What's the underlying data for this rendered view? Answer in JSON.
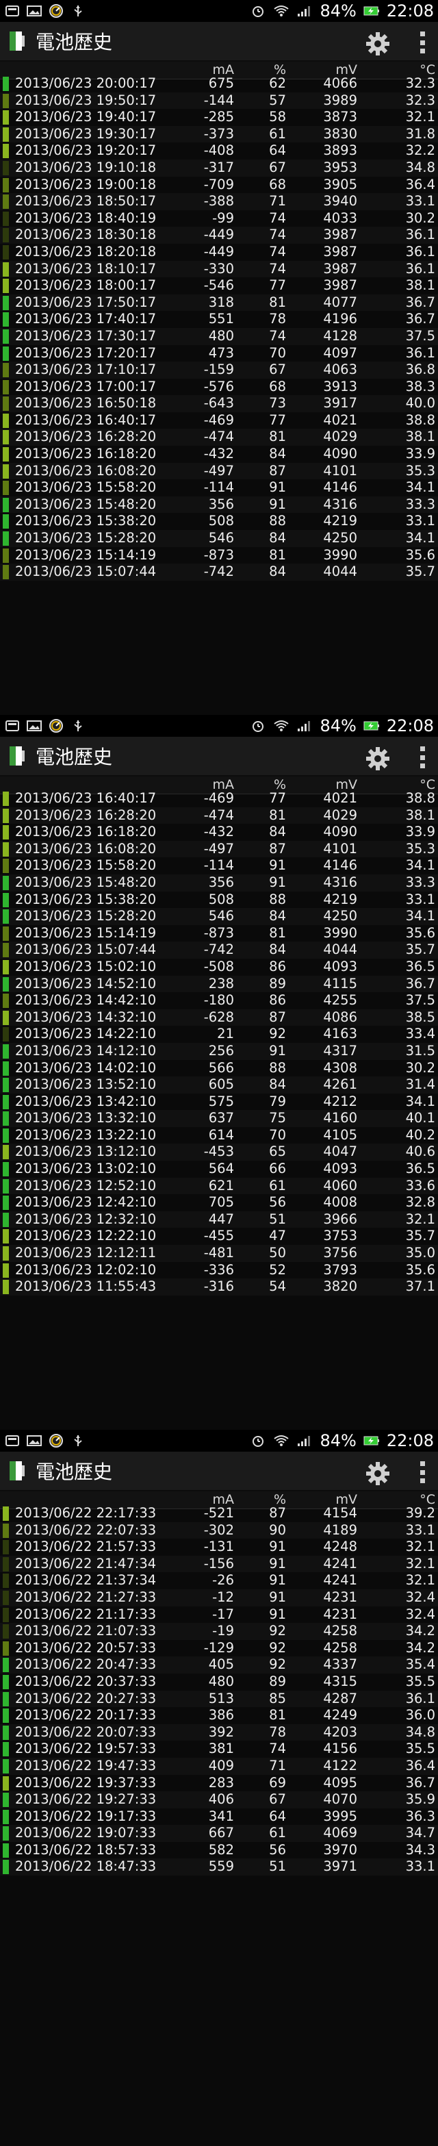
{
  "status": {
    "battery_pct": "84%",
    "clock": "22:08"
  },
  "app": {
    "title": "電池歴史"
  },
  "columns": {
    "ma": "mA",
    "pct": "%",
    "mv": "mV",
    "temp": "°C"
  },
  "colors": {
    "bar_green": "#2fb52f",
    "bar_yellow_green": "#8ab51f",
    "bar_olive": "#5f7a12",
    "bar_dark": "#2d3a0c"
  },
  "panels": [
    {
      "rows": [
        [
          "2013/06/23 20:00:17",
          "675",
          "62",
          "4066",
          "32.3",
          "green"
        ],
        [
          "2013/06/23 19:50:17",
          "-144",
          "57",
          "3989",
          "32.3",
          "olive"
        ],
        [
          "2013/06/23 19:40:17",
          "-285",
          "58",
          "3873",
          "32.1",
          "yg"
        ],
        [
          "2013/06/23 19:30:17",
          "-373",
          "61",
          "3830",
          "31.8",
          "yg"
        ],
        [
          "2013/06/23 19:20:17",
          "-408",
          "64",
          "3893",
          "32.2",
          "yg"
        ],
        [
          "2013/06/23 19:10:18",
          "-317",
          "67",
          "3953",
          "34.8",
          "dark"
        ],
        [
          "2013/06/23 19:00:18",
          "-709",
          "68",
          "3905",
          "36.4",
          "olive"
        ],
        [
          "2013/06/23 18:50:17",
          "-388",
          "71",
          "3940",
          "33.1",
          "olive"
        ],
        [
          "2013/06/23 18:40:19",
          "-99",
          "74",
          "4033",
          "30.2",
          "dark"
        ],
        [
          "2013/06/23 18:30:18",
          "-449",
          "74",
          "3987",
          "36.1",
          "dark"
        ],
        [
          "2013/06/23 18:20:18",
          "-449",
          "74",
          "3987",
          "36.1",
          "dark"
        ],
        [
          "2013/06/23 18:10:17",
          "-330",
          "74",
          "3987",
          "36.1",
          "yg"
        ],
        [
          "2013/06/23 18:00:17",
          "-546",
          "77",
          "3987",
          "38.1",
          "yg"
        ],
        [
          "2013/06/23 17:50:17",
          "318",
          "81",
          "4077",
          "36.7",
          "green"
        ],
        [
          "2013/06/23 17:40:17",
          "551",
          "78",
          "4196",
          "36.7",
          "green"
        ],
        [
          "2013/06/23 17:30:17",
          "480",
          "74",
          "4128",
          "37.5",
          "green"
        ],
        [
          "2013/06/23 17:20:17",
          "473",
          "70",
          "4097",
          "36.1",
          "green"
        ],
        [
          "2013/06/23 17:10:17",
          "-159",
          "67",
          "4063",
          "36.8",
          "olive"
        ],
        [
          "2013/06/23 17:00:17",
          "-576",
          "68",
          "3913",
          "38.3",
          "olive"
        ],
        [
          "2013/06/23 16:50:18",
          "-643",
          "73",
          "3917",
          "40.0",
          "olive"
        ],
        [
          "2013/06/23 16:40:17",
          "-469",
          "77",
          "4021",
          "38.8",
          "yg"
        ],
        [
          "2013/06/23 16:28:20",
          "-474",
          "81",
          "4029",
          "38.1",
          "yg"
        ],
        [
          "2013/06/23 16:18:20",
          "-432",
          "84",
          "4090",
          "33.9",
          "yg"
        ],
        [
          "2013/06/23 16:08:20",
          "-497",
          "87",
          "4101",
          "35.3",
          "yg"
        ],
        [
          "2013/06/23 15:58:20",
          "-114",
          "91",
          "4146",
          "34.1",
          "olive"
        ],
        [
          "2013/06/23 15:48:20",
          "356",
          "91",
          "4316",
          "33.3",
          "green"
        ],
        [
          "2013/06/23 15:38:20",
          "508",
          "88",
          "4219",
          "33.1",
          "green"
        ],
        [
          "2013/06/23 15:28:20",
          "546",
          "84",
          "4250",
          "34.1",
          "green"
        ],
        [
          "2013/06/23 15:14:19",
          "-873",
          "81",
          "3990",
          "35.6",
          "olive"
        ],
        [
          "2013/06/23 15:07:44",
          "-742",
          "84",
          "4044",
          "35.7",
          "olive"
        ]
      ]
    },
    {
      "rows": [
        [
          "2013/06/23 16:40:17",
          "-469",
          "77",
          "4021",
          "38.8",
          "yg"
        ],
        [
          "2013/06/23 16:28:20",
          "-474",
          "81",
          "4029",
          "38.1",
          "yg"
        ],
        [
          "2013/06/23 16:18:20",
          "-432",
          "84",
          "4090",
          "33.9",
          "yg"
        ],
        [
          "2013/06/23 16:08:20",
          "-497",
          "87",
          "4101",
          "35.3",
          "yg"
        ],
        [
          "2013/06/23 15:58:20",
          "-114",
          "91",
          "4146",
          "34.1",
          "olive"
        ],
        [
          "2013/06/23 15:48:20",
          "356",
          "91",
          "4316",
          "33.3",
          "green"
        ],
        [
          "2013/06/23 15:38:20",
          "508",
          "88",
          "4219",
          "33.1",
          "green"
        ],
        [
          "2013/06/23 15:28:20",
          "546",
          "84",
          "4250",
          "34.1",
          "green"
        ],
        [
          "2013/06/23 15:14:19",
          "-873",
          "81",
          "3990",
          "35.6",
          "olive"
        ],
        [
          "2013/06/23 15:07:44",
          "-742",
          "84",
          "4044",
          "35.7",
          "olive"
        ],
        [
          "2013/06/23 15:02:10",
          "-508",
          "86",
          "4093",
          "36.5",
          "yg"
        ],
        [
          "2013/06/23 14:52:10",
          "238",
          "89",
          "4115",
          "36.7",
          "green"
        ],
        [
          "2013/06/23 14:42:10",
          "-180",
          "86",
          "4255",
          "37.5",
          "olive"
        ],
        [
          "2013/06/23 14:32:10",
          "-628",
          "87",
          "4086",
          "38.5",
          "yg"
        ],
        [
          "2013/06/23 14:22:10",
          "21",
          "92",
          "4163",
          "33.4",
          "dark"
        ],
        [
          "2013/06/23 14:12:10",
          "256",
          "91",
          "4317",
          "31.5",
          "green"
        ],
        [
          "2013/06/23 14:02:10",
          "566",
          "88",
          "4308",
          "30.2",
          "green"
        ],
        [
          "2013/06/23 13:52:10",
          "605",
          "84",
          "4261",
          "31.4",
          "green"
        ],
        [
          "2013/06/23 13:42:10",
          "575",
          "79",
          "4212",
          "34.1",
          "green"
        ],
        [
          "2013/06/23 13:32:10",
          "637",
          "75",
          "4160",
          "40.1",
          "green"
        ],
        [
          "2013/06/23 13:22:10",
          "614",
          "70",
          "4105",
          "40.2",
          "green"
        ],
        [
          "2013/06/23 13:12:10",
          "-453",
          "65",
          "4047",
          "40.6",
          "yg"
        ],
        [
          "2013/06/23 13:02:10",
          "564",
          "66",
          "4093",
          "36.5",
          "green"
        ],
        [
          "2013/06/23 12:52:10",
          "621",
          "61",
          "4060",
          "33.6",
          "green"
        ],
        [
          "2013/06/23 12:42:10",
          "705",
          "56",
          "4008",
          "32.8",
          "green"
        ],
        [
          "2013/06/23 12:32:10",
          "447",
          "51",
          "3966",
          "32.1",
          "green"
        ],
        [
          "2013/06/23 12:22:10",
          "-455",
          "47",
          "3753",
          "35.7",
          "yg"
        ],
        [
          "2013/06/23 12:12:11",
          "-481",
          "50",
          "3756",
          "35.0",
          "yg"
        ],
        [
          "2013/06/23 12:02:10",
          "-336",
          "52",
          "3793",
          "35.6",
          "yg"
        ],
        [
          "2013/06/23 11:55:43",
          "-316",
          "54",
          "3820",
          "37.1",
          "yg"
        ]
      ]
    },
    {
      "rows": [
        [
          "2013/06/22 22:17:33",
          "-521",
          "87",
          "4154",
          "39.2",
          "yg"
        ],
        [
          "2013/06/22 22:07:33",
          "-302",
          "90",
          "4189",
          "33.1",
          "olive"
        ],
        [
          "2013/06/22 21:57:33",
          "-131",
          "91",
          "4248",
          "32.1",
          "dark"
        ],
        [
          "2013/06/22 21:47:34",
          "-156",
          "91",
          "4241",
          "32.1",
          "dark"
        ],
        [
          "2013/06/22 21:37:34",
          "-26",
          "91",
          "4241",
          "32.1",
          "dark"
        ],
        [
          "2013/06/22 21:27:33",
          "-12",
          "91",
          "4231",
          "32.4",
          "dark"
        ],
        [
          "2013/06/22 21:17:33",
          "-17",
          "91",
          "4231",
          "32.4",
          "dark"
        ],
        [
          "2013/06/22 21:07:33",
          "-19",
          "92",
          "4258",
          "34.2",
          "dark"
        ],
        [
          "2013/06/22 20:57:33",
          "-129",
          "92",
          "4258",
          "34.2",
          "olive"
        ],
        [
          "2013/06/22 20:47:33",
          "405",
          "92",
          "4337",
          "35.4",
          "green"
        ],
        [
          "2013/06/22 20:37:33",
          "480",
          "89",
          "4315",
          "35.5",
          "green"
        ],
        [
          "2013/06/22 20:27:33",
          "513",
          "85",
          "4287",
          "36.1",
          "green"
        ],
        [
          "2013/06/22 20:17:33",
          "386",
          "81",
          "4249",
          "36.0",
          "green"
        ],
        [
          "2013/06/22 20:07:33",
          "392",
          "78",
          "4203",
          "34.8",
          "green"
        ],
        [
          "2013/06/22 19:57:33",
          "381",
          "74",
          "4156",
          "35.5",
          "green"
        ],
        [
          "2013/06/22 19:47:33",
          "409",
          "71",
          "4122",
          "36.4",
          "green"
        ],
        [
          "2013/06/22 19:37:33",
          "283",
          "69",
          "4095",
          "36.7",
          "yg"
        ],
        [
          "2013/06/22 19:27:33",
          "406",
          "67",
          "4070",
          "35.9",
          "green"
        ],
        [
          "2013/06/22 19:17:33",
          "341",
          "64",
          "3995",
          "36.3",
          "green"
        ],
        [
          "2013/06/22 19:07:33",
          "667",
          "61",
          "4069",
          "34.7",
          "green"
        ],
        [
          "2013/06/22 18:57:33",
          "582",
          "56",
          "3970",
          "34.3",
          "green"
        ],
        [
          "2013/06/22 18:47:33",
          "559",
          "51",
          "3971",
          "33.1",
          "green"
        ]
      ]
    }
  ]
}
